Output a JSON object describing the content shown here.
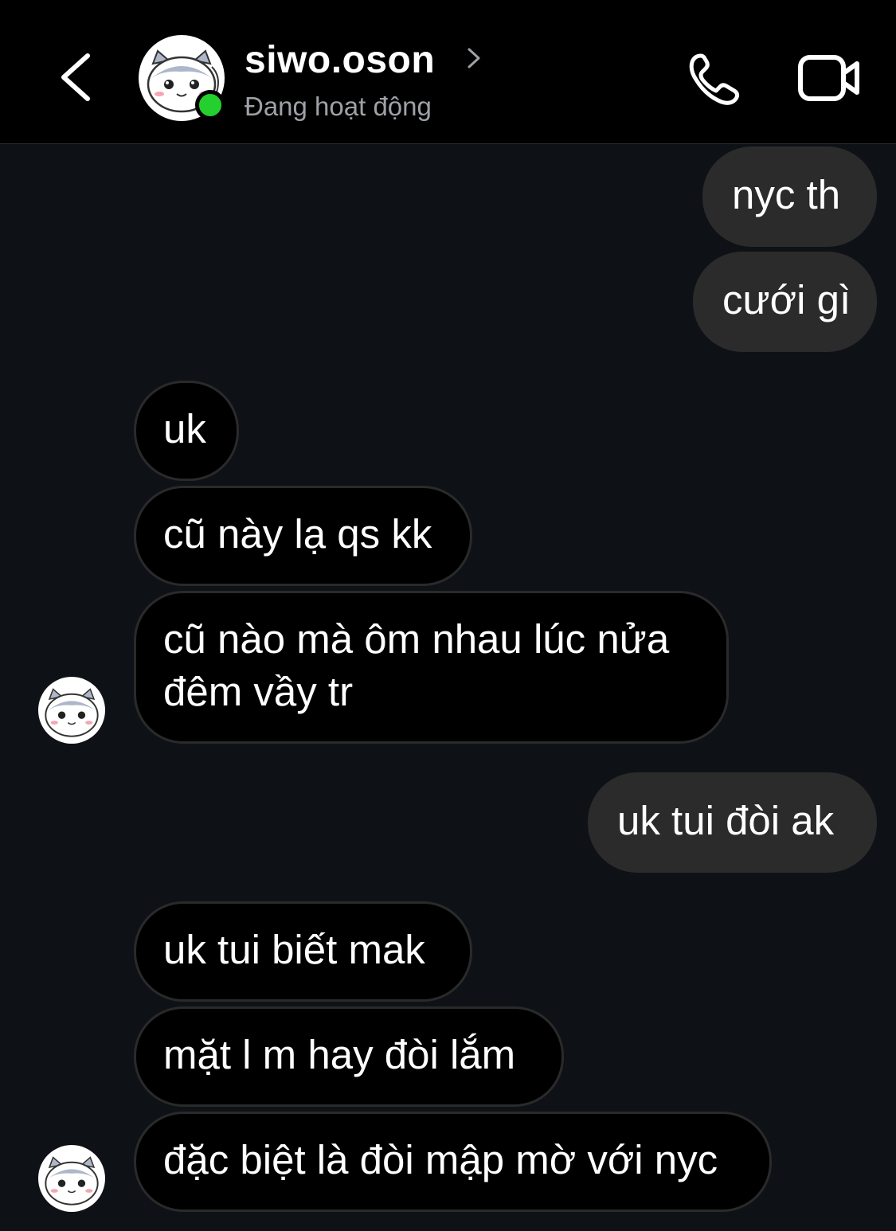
{
  "header": {
    "contact_name": "siwo.oson",
    "status": "Đang hoạt động"
  },
  "messages": [
    {
      "side": "outgoing",
      "text": "nyc th"
    },
    {
      "side": "outgoing",
      "text": "cưới gì"
    },
    {
      "side": "incoming",
      "text": "uk"
    },
    {
      "side": "incoming",
      "text": "cũ này lạ qs kk"
    },
    {
      "side": "incoming",
      "line1": "cũ nào mà ôm nhau lúc nửa",
      "line2": "đêm vầy tr"
    },
    {
      "side": "outgoing",
      "text": "uk tui đòi ak"
    },
    {
      "side": "incoming",
      "text": "uk tui biết mak"
    },
    {
      "side": "incoming",
      "text": "mặt l m hay đòi lắm"
    },
    {
      "side": "incoming",
      "text": "đặc biệt là đòi mập mờ với nyc"
    }
  ],
  "colors": {
    "background": "#0e1217",
    "header": "#000000",
    "outgoing_bubble": "#2b2b2b",
    "incoming_bubble": "#000000",
    "online": "#23d02e"
  },
  "icons": [
    "back-chevron-icon",
    "avatar-cat-icon",
    "online-status-dot",
    "chevron-right-icon",
    "phone-call-icon",
    "video-call-icon"
  ]
}
